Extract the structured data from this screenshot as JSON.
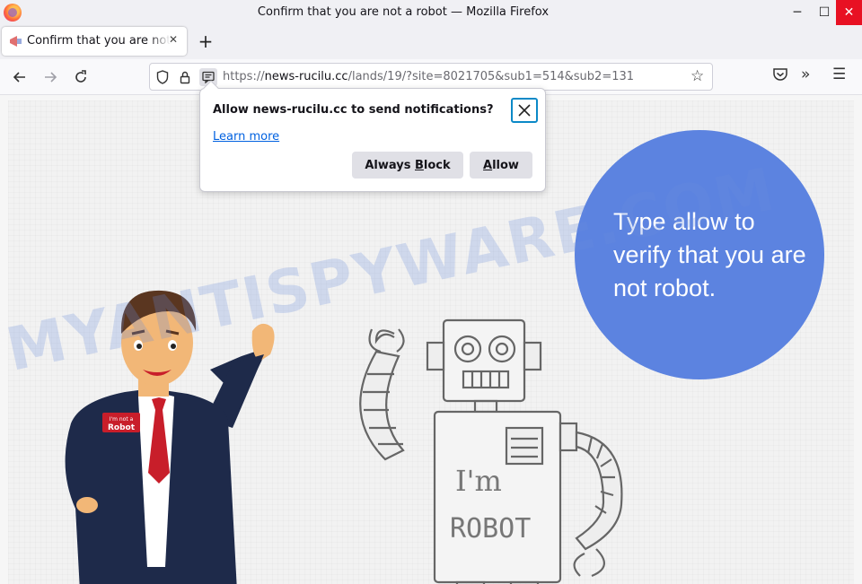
{
  "window": {
    "title": "Confirm that you are not a robot — Mozilla Firefox",
    "minimize_label": "─",
    "maximize_label": "☐",
    "close_label": "✕"
  },
  "tab": {
    "title": "Confirm that you are not a robot",
    "close_label": "✕",
    "new_tab_label": "+"
  },
  "navbar": {
    "url_prefix": "https://",
    "url_host": "news-rucilu.cc",
    "url_rest": "/lands/19/?site=8021705&sub1=514&sub2=131"
  },
  "notification_prompt": {
    "message": "Allow news-rucilu.cc to send notifications?",
    "learn_more": "Learn more",
    "block_label_pre": "Always ",
    "block_label_key": "B",
    "block_label_post": "lock",
    "allow_label_key": "A",
    "allow_label_post": "llow"
  },
  "page": {
    "bubble_text": "Type allow to verify that you are not robot.",
    "badge_line1": "I'm not a",
    "badge_line2": "Robot",
    "robot_text_line1": "I'm",
    "robot_text_line2": "ROBOT",
    "watermark": "MYANTISPYWARE.COM",
    "bubble_color": "#5c83e0"
  }
}
